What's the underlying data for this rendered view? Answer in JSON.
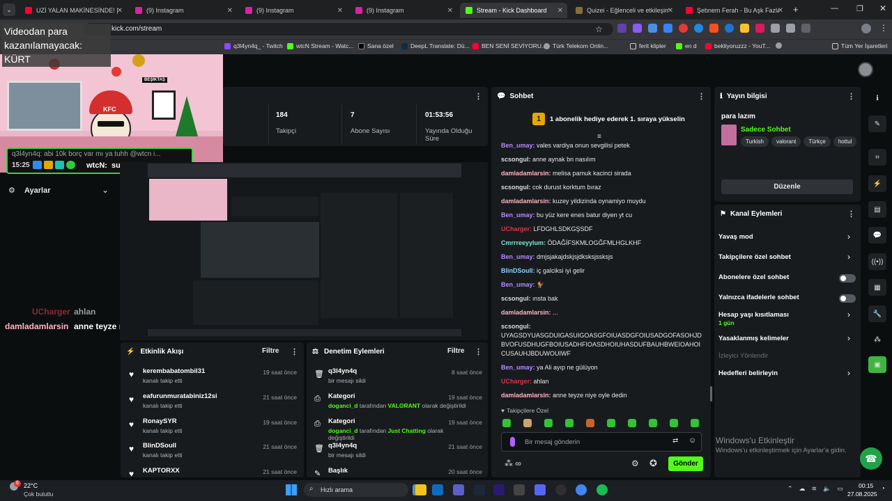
{
  "browser": {
    "tabs": [
      {
        "label": "UZİ YALAN MAKİNESİNDE! | #P",
        "icon": "youtube-icon",
        "color": "#ff0033"
      },
      {
        "label": "(9) Instagram",
        "icon": "instagram-icon",
        "color": "#d6249f"
      },
      {
        "label": "(9) Instagram",
        "icon": "instagram-icon",
        "color": "#d6249f"
      },
      {
        "label": "(9) Instagram",
        "icon": "instagram-icon",
        "color": "#d6249f"
      },
      {
        "label": "Stream - Kick Dashboard",
        "icon": "kick-icon",
        "color": "#53fc18"
      },
      {
        "label": "Quizei - Eğlenceli ve etkileşim",
        "icon": "quiz-icon",
        "color": "#8a6d3b"
      },
      {
        "label": "Şebnem Ferah - Bu Aşk Fazla S",
        "icon": "youtube-icon",
        "color": "#ff0033"
      }
    ],
    "url": "kick.com/stream",
    "bookmarks": [
      "q3l4yn4q_ - Twitch",
      "wtcN Stream - Watc...",
      "Sana özel",
      "DeepL Translate: Dü...",
      "BEN SENİ SEVİYORU...",
      "Türk Telekom Onlin...",
      "ferit klipler",
      "en d",
      "bekliyoruzzz - YouT...",
      "Tüm Yer İşaretleri"
    ]
  },
  "overlay": {
    "banner": "Videodan para kazanılamayacak: KÜRT",
    "frame_label": "BEŞİKTAŞ",
    "hat_text": "KFC",
    "reply": "q3l4yn4q: abi 10k borç var mı ya tuhh @wtcn i...",
    "reply_time": "15:25",
    "reply_user": "wtcN:",
    "reply_msg": "sus lan çalış",
    "chat_lines": [
      {
        "user": "UCharger",
        "text": "ahlan",
        "color": "#e0304a"
      },
      {
        "user": "damladamlarsin",
        "text": "anne teyze niye oyle dedin",
        "color": "#ffb3c0"
      }
    ]
  },
  "stats": [
    {
      "value": "184",
      "label": "Takipçi"
    },
    {
      "value": "7",
      "label": "Abone Sayısı"
    },
    {
      "value": "01:53:56",
      "label": "Yayında Olduğu Süre"
    }
  ],
  "settings_label": "Ayarlar",
  "chat": {
    "title": "Sohbet",
    "pinned": "1 abonelik hediye ederek 1. sıraya yükselin",
    "pinned_rank": "1",
    "messages": [
      {
        "user": "Ben_umay:",
        "text": "vales vardiya onun sevgilisi petek",
        "color": "#b28cff"
      },
      {
        "user": "scsongul:",
        "text": "anne aynak bn nasılım",
        "color": "#d9dce0"
      },
      {
        "user": "damladamlarsin:",
        "text": "melisa pamuk kacinci sirada",
        "color": "#ffb3c0"
      },
      {
        "user": "scsongul:",
        "text": "cok durust korktum bıraz",
        "color": "#d9dce0"
      },
      {
        "user": "damladamlarsin:",
        "text": "kuzey yildizinda oynamiyo muydu",
        "color": "#ffb3c0"
      },
      {
        "user": "Ben_umay:",
        "text": "bu yüz kere enes batur diyen yt cu",
        "color": "#b28cff"
      },
      {
        "user": "UCharger:",
        "text": "LFDGHLSDKGŞSDF",
        "color": "#e0304a"
      },
      {
        "user": "Cmrrreeyylum:",
        "text": "ÖDAĞİFSKMLOGĞFMLHGLKHF",
        "color": "#7fe3d6"
      },
      {
        "user": "Ben_umay:",
        "text": "dmjsjakajdskjsjdksksjssksjs",
        "color": "#b28cff"
      },
      {
        "user": "BlinDSoull:",
        "text": "iç galciksi iyi gelir",
        "color": "#8fd0ff"
      },
      {
        "user": "Ben_umay:",
        "text": "🐓",
        "color": "#b28cff"
      },
      {
        "user": "scsongul:",
        "text": "ınsta bak",
        "color": "#d9dce0"
      },
      {
        "user": "damladamlarsin:",
        "text": "...",
        "color": "#ffb3c0"
      },
      {
        "user": "scsongul:",
        "text": "UYAGSDYUASGDUIGASUIGOASGFOIUASDGFOIUSADGOFASOHJDBVOFUSDHUGFBOIUSADHFIOASDHOIUHASDUFBAUHBWEIOAHOICUSAUHJBDUWOUIWF",
        "color": "#d9dce0"
      },
      {
        "user": "Ben_umay:",
        "text": "ya Ali ayıp ne gülüyon",
        "color": "#b28cff"
      },
      {
        "user": "UCharger:",
        "text": "ahlan",
        "color": "#e0304a"
      },
      {
        "user": "damladamlarsin:",
        "text": "anne teyze niye oyle dedin",
        "color": "#ffb3c0"
      }
    ],
    "mode": "Takipçilere Özel",
    "placeholder": "Bir mesaj gönderin",
    "send": "Gönder"
  },
  "stream_info": {
    "title": "Yayın bilgisi",
    "stream_title": "para lazım",
    "category": "Sadece Sohbet",
    "tags": [
      "Turkish",
      "valorant",
      "Türkçe",
      "hottul"
    ],
    "edit": "Düzenle"
  },
  "channel_actions": {
    "title": "Kanal Eylemleri",
    "items": [
      {
        "label": "Yavaş mod",
        "control": "chevron"
      },
      {
        "label": "Takipçilere özel sohbet",
        "control": "chevron"
      },
      {
        "label": "Abonelere özel sohbet",
        "control": "toggle"
      },
      {
        "label": "Yalnızca ifadelerle sohbet",
        "control": "toggle"
      },
      {
        "label": "Hesap yaşı kısıtlaması",
        "control": "chevron",
        "sub": "1 gün"
      },
      {
        "label": "Yasaklanmış kelimeler",
        "control": "chevron"
      },
      {
        "label": "İzleyici Yönlendir",
        "control": "none"
      },
      {
        "label": "Hedefleri belirleyin",
        "control": "chevron"
      }
    ]
  },
  "activity": {
    "title": "Etkinlik Akışı",
    "filter": "Filtre",
    "items": [
      {
        "name": "kerembabatombil31",
        "desc": "kanalı takip etti",
        "time": "19 saat önce"
      },
      {
        "name": "eafurunmuratabiniz12si",
        "desc": "kanalı takip etti",
        "time": "21 saat önce"
      },
      {
        "name": "RonaySYR",
        "desc": "kanalı takip etti",
        "time": "19 saat önce"
      },
      {
        "name": "BlinDSoull",
        "desc": "kanalı takip etti",
        "time": "21 saat önce"
      },
      {
        "name": "KAPTORXX",
        "desc": "",
        "time": "21 saat önce"
      }
    ]
  },
  "moderation": {
    "title": "Denetim Eylemleri",
    "filter": "Filtre",
    "items": [
      {
        "name": "q3l4yn4q",
        "desc": "bir mesajı sildi",
        "time": "8 saat önce",
        "icon": "trash-icon"
      },
      {
        "name": "Kategori",
        "actor": "doganci_d",
        "mid": "tarafından",
        "value": "VALORANT",
        "post": "olarak değiştirildi",
        "time": "19 saat önce",
        "icon": "category-icon"
      },
      {
        "name": "Kategori",
        "actor": "doganci_d",
        "mid": "tarafından",
        "value": "Just Chatting",
        "post": "olarak değiştirildi",
        "time": "19 saat önce",
        "icon": "category-icon"
      },
      {
        "name": "q3l4yn4q",
        "desc": "bir mesajı sildi",
        "time": "21 saat önce",
        "icon": "trash-icon"
      },
      {
        "name": "Başlık",
        "desc": "",
        "time": "20 saat önce",
        "icon": "title-icon"
      }
    ]
  },
  "windows": {
    "watermark_title": "Windows'u Etkinleştir",
    "watermark_sub": "Windows'u etkinleştirmek için Ayarlar'a gidin.",
    "weather_temp": "22°C",
    "weather_desc": "Çok bulutlu",
    "weather_badge": "6",
    "search": "Hızlı arama",
    "clock": "00:15",
    "date": "27.08.2025"
  }
}
